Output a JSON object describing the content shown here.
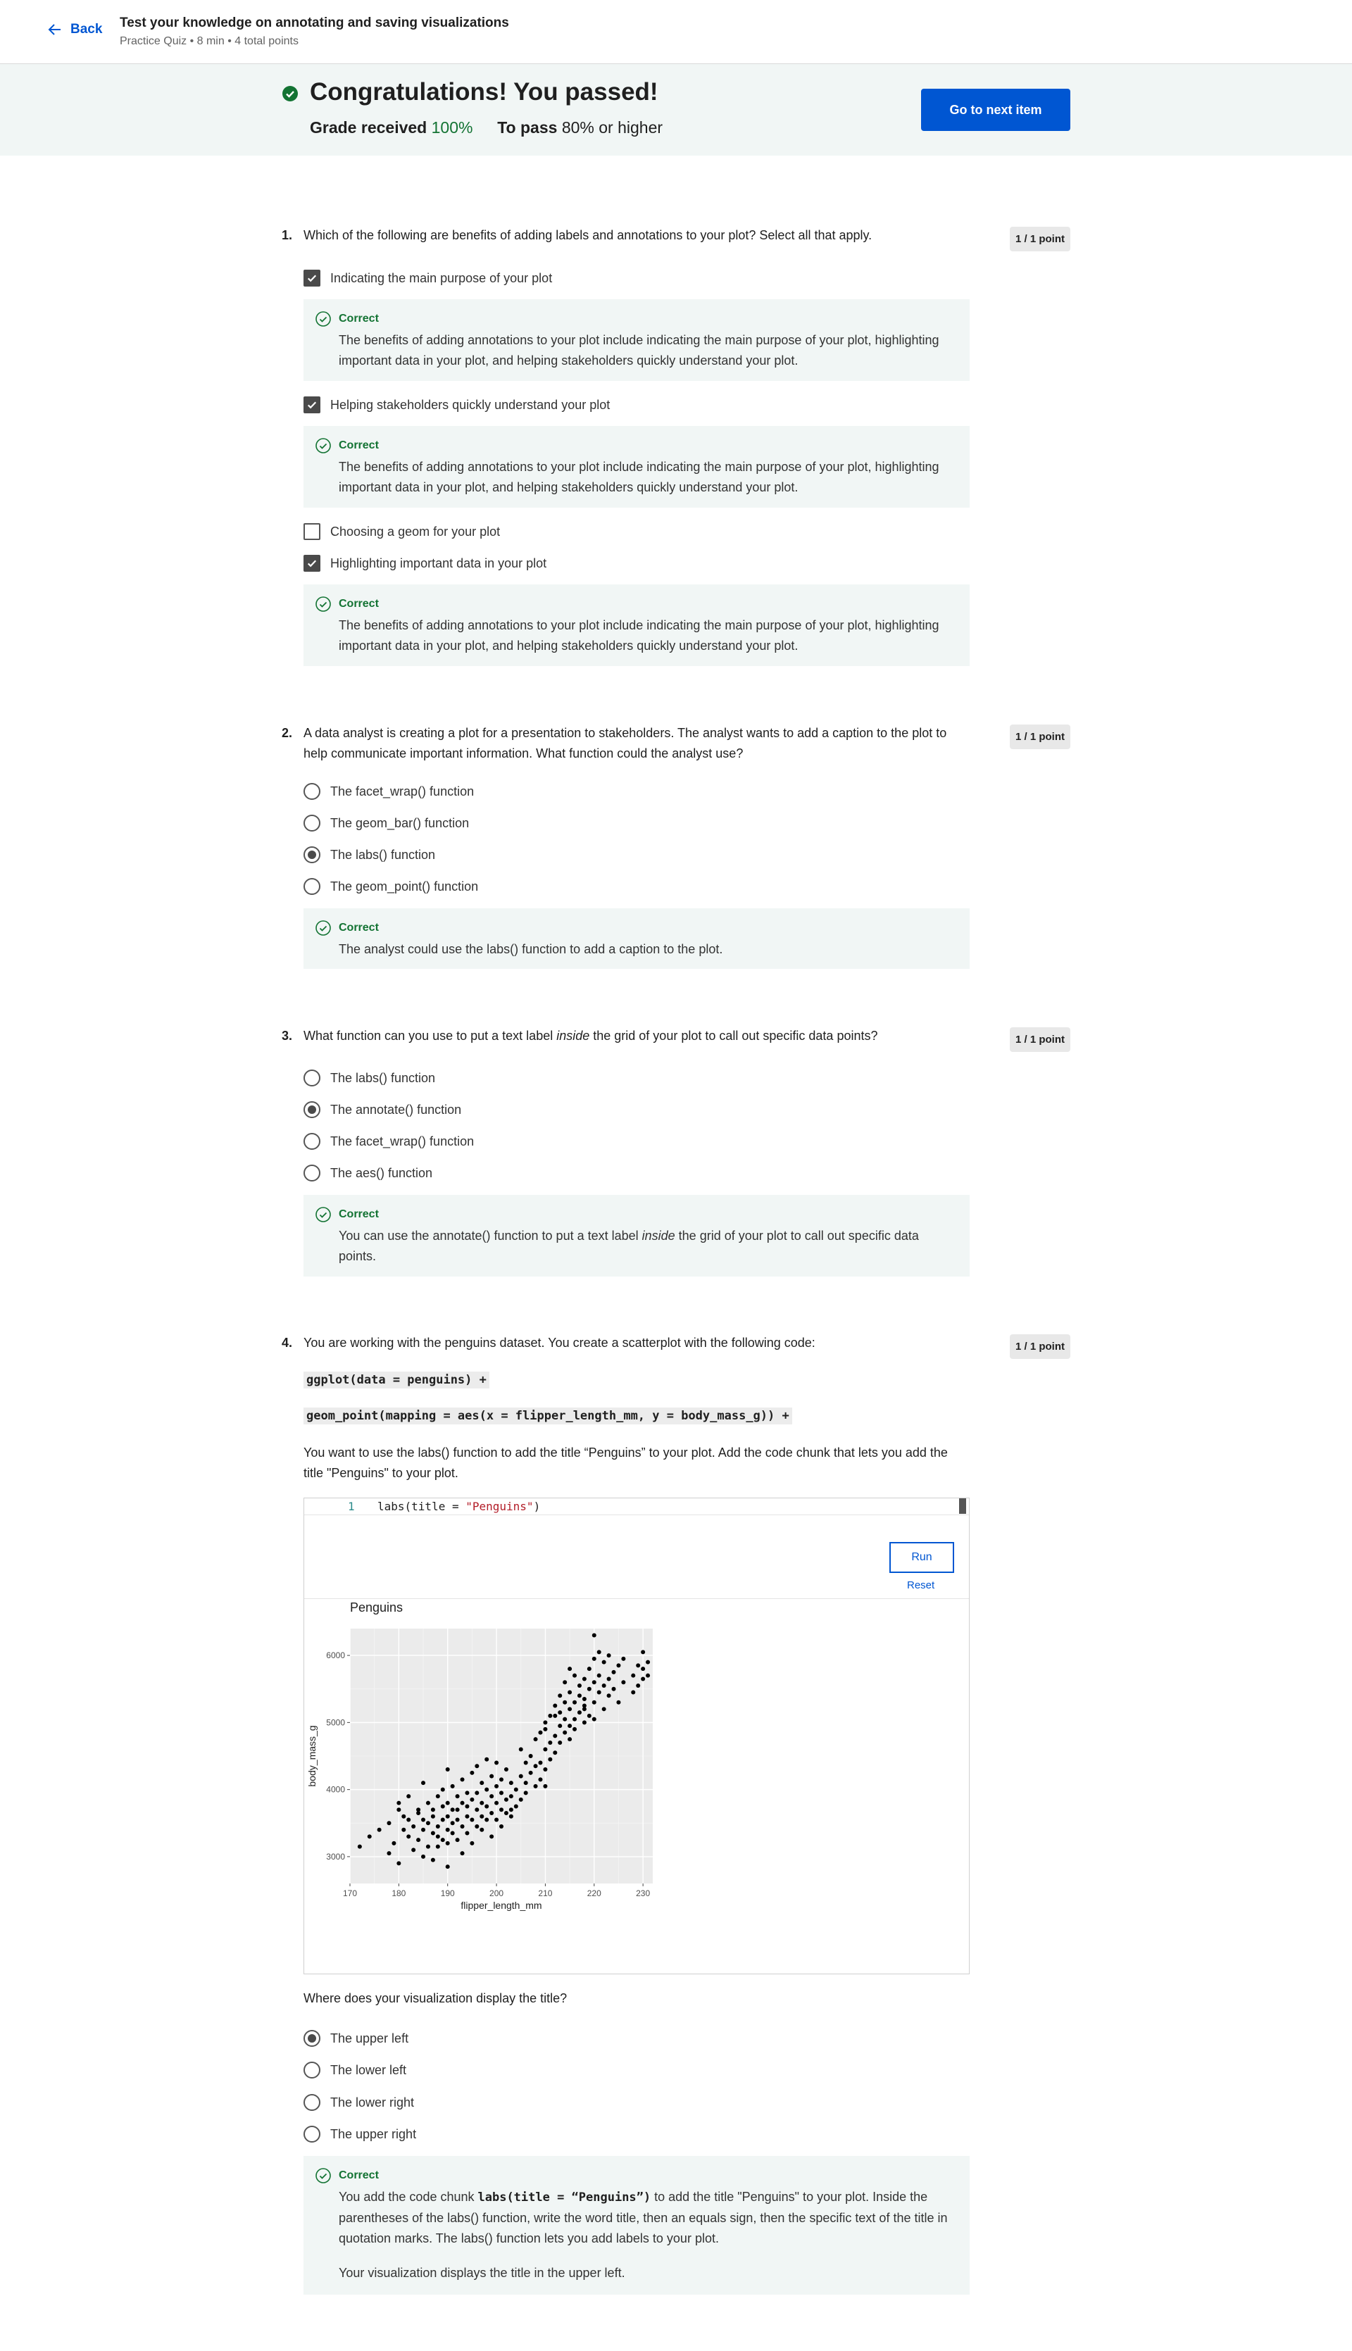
{
  "header": {
    "back_label": "Back",
    "title": "Test your knowledge on annotating and saving visualizations",
    "meta": "Practice Quiz • 8 min • 4 total points"
  },
  "banner": {
    "title": "Congratulations! You passed!",
    "grade_label": "Grade received",
    "grade_value": "100%",
    "pass_label": "To pass",
    "pass_value": "80% or higher",
    "next_button": "Go to next item"
  },
  "colors": {
    "accent": "#0056d2",
    "correct": "#137333",
    "feedback_bg": "#f1f6f5"
  },
  "correct_label": "Correct",
  "questions": [
    {
      "number": "1.",
      "text": "Which of the following are benefits of adding labels and annotations to your plot? Select all that apply.",
      "points": "1 / 1 point",
      "options": [
        {
          "label": "Indicating the main purpose of your plot",
          "checked": true
        },
        {
          "label": "Helping stakeholders quickly understand your plot",
          "checked": true
        },
        {
          "label": "Choosing a geom for your plot",
          "checked": false
        },
        {
          "label": "Highlighting important data in your plot",
          "checked": true
        }
      ],
      "feedback": "The benefits of adding annotations to your plot include indicating the main purpose of your plot, highlighting important data in your plot, and helping stakeholders quickly understand your plot."
    },
    {
      "number": "2.",
      "text": "A data analyst is creating a plot for a presentation to stakeholders. The analyst wants to add a caption to the plot to help communicate important information. What function could the analyst use?",
      "points": "1 / 1 point",
      "options": [
        {
          "label": "The facet_wrap() function",
          "checked": false
        },
        {
          "label": "The geom_bar() function",
          "checked": false
        },
        {
          "label": "The labs() function",
          "checked": true
        },
        {
          "label": "The geom_point() function",
          "checked": false
        }
      ],
      "feedback": "The analyst could use the labs() function to add a caption to the plot."
    },
    {
      "number": "3.",
      "text_before": "What function can you use to put a text label ",
      "text_em": "inside",
      "text_after": " the grid of your plot to call out specific data points?",
      "points": "1 / 1 point",
      "options": [
        {
          "label": "The labs() function",
          "checked": false
        },
        {
          "label": "The annotate() function",
          "checked": true
        },
        {
          "label": "The facet_wrap() function",
          "checked": false
        },
        {
          "label": "The aes() function",
          "checked": false
        }
      ],
      "feedback_before": "You can use the annotate() function to put a text label ",
      "feedback_em": "inside",
      "feedback_after": " the grid of your plot to call out specific data points."
    },
    {
      "number": "4.",
      "text": "You are working with the penguins dataset. You create a scatterplot with the following code:",
      "points": "1 / 1 point",
      "code_lines": [
        "ggplot(data = penguins) +",
        "geom_point(mapping = aes(x = flipper_length_mm, y = body_mass_g)) +"
      ],
      "instruction": "You want to use the labs() function to add the title “Penguins” to your plot. Add the code chunk that lets you add the title \"Penguins\" to your plot.",
      "editor": {
        "line_number": "1",
        "code_prefix": "labs(title = ",
        "code_string": "\"Penguins\"",
        "code_suffix": ")",
        "run_label": "Run",
        "reset_label": "Reset"
      },
      "followup": "Where does your visualization display the title?",
      "options": [
        {
          "label": "The upper left",
          "checked": true
        },
        {
          "label": "The lower left",
          "checked": false
        },
        {
          "label": "The lower right",
          "checked": false
        },
        {
          "label": "The upper right",
          "checked": false
        }
      ],
      "feedback_before": "You add the code chunk ",
      "feedback_code": "labs(title = “Penguins”)",
      "feedback_after": " to add the title \"Penguins\" to your plot. Inside the parentheses of the labs() function, write the word title, then an equals sign, then the specific text of the title in quotation marks. The labs() function lets you add labels to your plot.",
      "feedback_2": "Your visualization displays the title in the upper left."
    }
  ],
  "chart_data": {
    "type": "scatter",
    "title": "Penguins",
    "xlabel": "flipper_length_mm",
    "ylabel": "body_mass_g",
    "xlim": [
      170,
      232
    ],
    "ylim": [
      2600,
      6400
    ],
    "xticks": [
      170,
      180,
      190,
      200,
      210,
      220,
      230
    ],
    "yticks": [
      3000,
      4000,
      5000,
      6000
    ],
    "grid": true,
    "points": [
      [
        172,
        3150
      ],
      [
        174,
        3300
      ],
      [
        176,
        3400
      ],
      [
        178,
        3050
      ],
      [
        178,
        3500
      ],
      [
        179,
        3200
      ],
      [
        180,
        3700
      ],
      [
        180,
        3800
      ],
      [
        180,
        2900
      ],
      [
        181,
        3400
      ],
      [
        181,
        3600
      ],
      [
        182,
        3550
      ],
      [
        182,
        3300
      ],
      [
        182,
        3900
      ],
      [
        183,
        3100
      ],
      [
        183,
        3450
      ],
      [
        184,
        3650
      ],
      [
        184,
        3250
      ],
      [
        184,
        3700
      ],
      [
        185,
        3550
      ],
      [
        185,
        3000
      ],
      [
        185,
        4100
      ],
      [
        185,
        3400
      ],
      [
        186,
        3150
      ],
      [
        186,
        3800
      ],
      [
        186,
        3500
      ],
      [
        187,
        3350
      ],
      [
        187,
        3700
      ],
      [
        187,
        2950
      ],
      [
        187,
        3600
      ],
      [
        188,
        3300
      ],
      [
        188,
        3900
      ],
      [
        188,
        3450
      ],
      [
        188,
        3150
      ],
      [
        189,
        3550
      ],
      [
        189,
        3750
      ],
      [
        189,
        3250
      ],
      [
        189,
        4000
      ],
      [
        190,
        3400
      ],
      [
        190,
        3600
      ],
      [
        190,
        3800
      ],
      [
        190,
        3200
      ],
      [
        190,
        2850
      ],
      [
        190,
        4300
      ],
      [
        191,
        3500
      ],
      [
        191,
        3700
      ],
      [
        191,
        3350
      ],
      [
        191,
        4050
      ],
      [
        192,
        3550
      ],
      [
        192,
        3900
      ],
      [
        192,
        3250
      ],
      [
        192,
        3700
      ],
      [
        193,
        3450
      ],
      [
        193,
        3800
      ],
      [
        193,
        3050
      ],
      [
        193,
        4150
      ],
      [
        194,
        3600
      ],
      [
        194,
        3950
      ],
      [
        194,
        3350
      ],
      [
        194,
        3750
      ],
      [
        195,
        3550
      ],
      [
        195,
        3850
      ],
      [
        195,
        3200
      ],
      [
        195,
        4250
      ],
      [
        196,
        3700
      ],
      [
        196,
        3450
      ],
      [
        196,
        3950
      ],
      [
        196,
        4350
      ],
      [
        197,
        3600
      ],
      [
        197,
        3800
      ],
      [
        197,
        3400
      ],
      [
        197,
        4100
      ],
      [
        198,
        3750
      ],
      [
        198,
        3550
      ],
      [
        198,
        4000
      ],
      [
        198,
        4450
      ],
      [
        199,
        3650
      ],
      [
        199,
        3900
      ],
      [
        199,
        3300
      ],
      [
        199,
        4200
      ],
      [
        200,
        3800
      ],
      [
        200,
        3550
      ],
      [
        200,
        4050
      ],
      [
        200,
        4400
      ],
      [
        201,
        3700
      ],
      [
        201,
        3950
      ],
      [
        201,
        3450
      ],
      [
        201,
        4150
      ],
      [
        202,
        3850
      ],
      [
        202,
        3650
      ],
      [
        202,
        4300
      ],
      [
        203,
        3900
      ],
      [
        203,
        4100
      ],
      [
        203,
        3600
      ],
      [
        204,
        4000
      ],
      [
        204,
        3750
      ],
      [
        205,
        4200
      ],
      [
        205,
        3850
      ],
      [
        205,
        4600
      ],
      [
        206,
        4100
      ],
      [
        206,
        3950
      ],
      [
        207,
        4250
      ],
      [
        207,
        4500
      ],
      [
        208,
        4350
      ],
      [
        208,
        4750
      ],
      [
        208,
        4050
      ],
      [
        209,
        4400
      ],
      [
        209,
        4850
      ],
      [
        209,
        4150
      ],
      [
        210,
        4600
      ],
      [
        210,
        4900
      ],
      [
        210,
        4300
      ],
      [
        210,
        4050
      ],
      [
        210,
        5000
      ],
      [
        211,
        4700
      ],
      [
        211,
        5100
      ],
      [
        211,
        4450
      ],
      [
        212,
        4800
      ],
      [
        212,
        5250
      ],
      [
        212,
        4550
      ],
      [
        213,
        4950
      ],
      [
        213,
        5400
      ],
      [
        213,
        4700
      ],
      [
        213,
        5150
      ],
      [
        214,
        5050
      ],
      [
        214,
        4850
      ],
      [
        214,
        5600
      ],
      [
        215,
        5200
      ],
      [
        215,
        4950
      ],
      [
        215,
        5450
      ],
      [
        215,
        4750
      ],
      [
        215,
        5800
      ],
      [
        216,
        5300
      ],
      [
        216,
        5050
      ],
      [
        216,
        5700
      ],
      [
        216,
        4900
      ],
      [
        217,
        5400
      ],
      [
        217,
        5150
      ],
      [
        217,
        5550
      ],
      [
        218,
        5250
      ],
      [
        218,
        5000
      ],
      [
        218,
        5650
      ],
      [
        218,
        5350
      ],
      [
        219,
        5500
      ],
      [
        219,
        5100
      ],
      [
        219,
        5800
      ],
      [
        220,
        5600
      ],
      [
        220,
        5300
      ],
      [
        220,
        5950
      ],
      [
        220,
        5050
      ],
      [
        221,
        5700
      ],
      [
        221,
        5450
      ],
      [
        221,
        6050
      ],
      [
        222,
        5550
      ],
      [
        222,
        5200
      ],
      [
        222,
        5900
      ],
      [
        223,
        5650
      ],
      [
        223,
        5400
      ],
      [
        223,
        6000
      ],
      [
        224,
        5750
      ],
      [
        224,
        5500
      ],
      [
        225,
        5850
      ],
      [
        225,
        5300
      ],
      [
        226,
        5600
      ],
      [
        226,
        5950
      ],
      [
        228,
        5450
      ],
      [
        228,
        5700
      ],
      [
        229,
        5850
      ],
      [
        229,
        5550
      ],
      [
        230,
        6050
      ],
      [
        230,
        5800
      ],
      [
        230,
        5650
      ],
      [
        231,
        5900
      ],
      [
        231,
        5700
      ],
      [
        220,
        6300
      ],
      [
        218,
        5200
      ],
      [
        214,
        5300
      ],
      [
        212,
        5100
      ],
      [
        206,
        4400
      ],
      [
        203,
        3700
      ]
    ]
  }
}
